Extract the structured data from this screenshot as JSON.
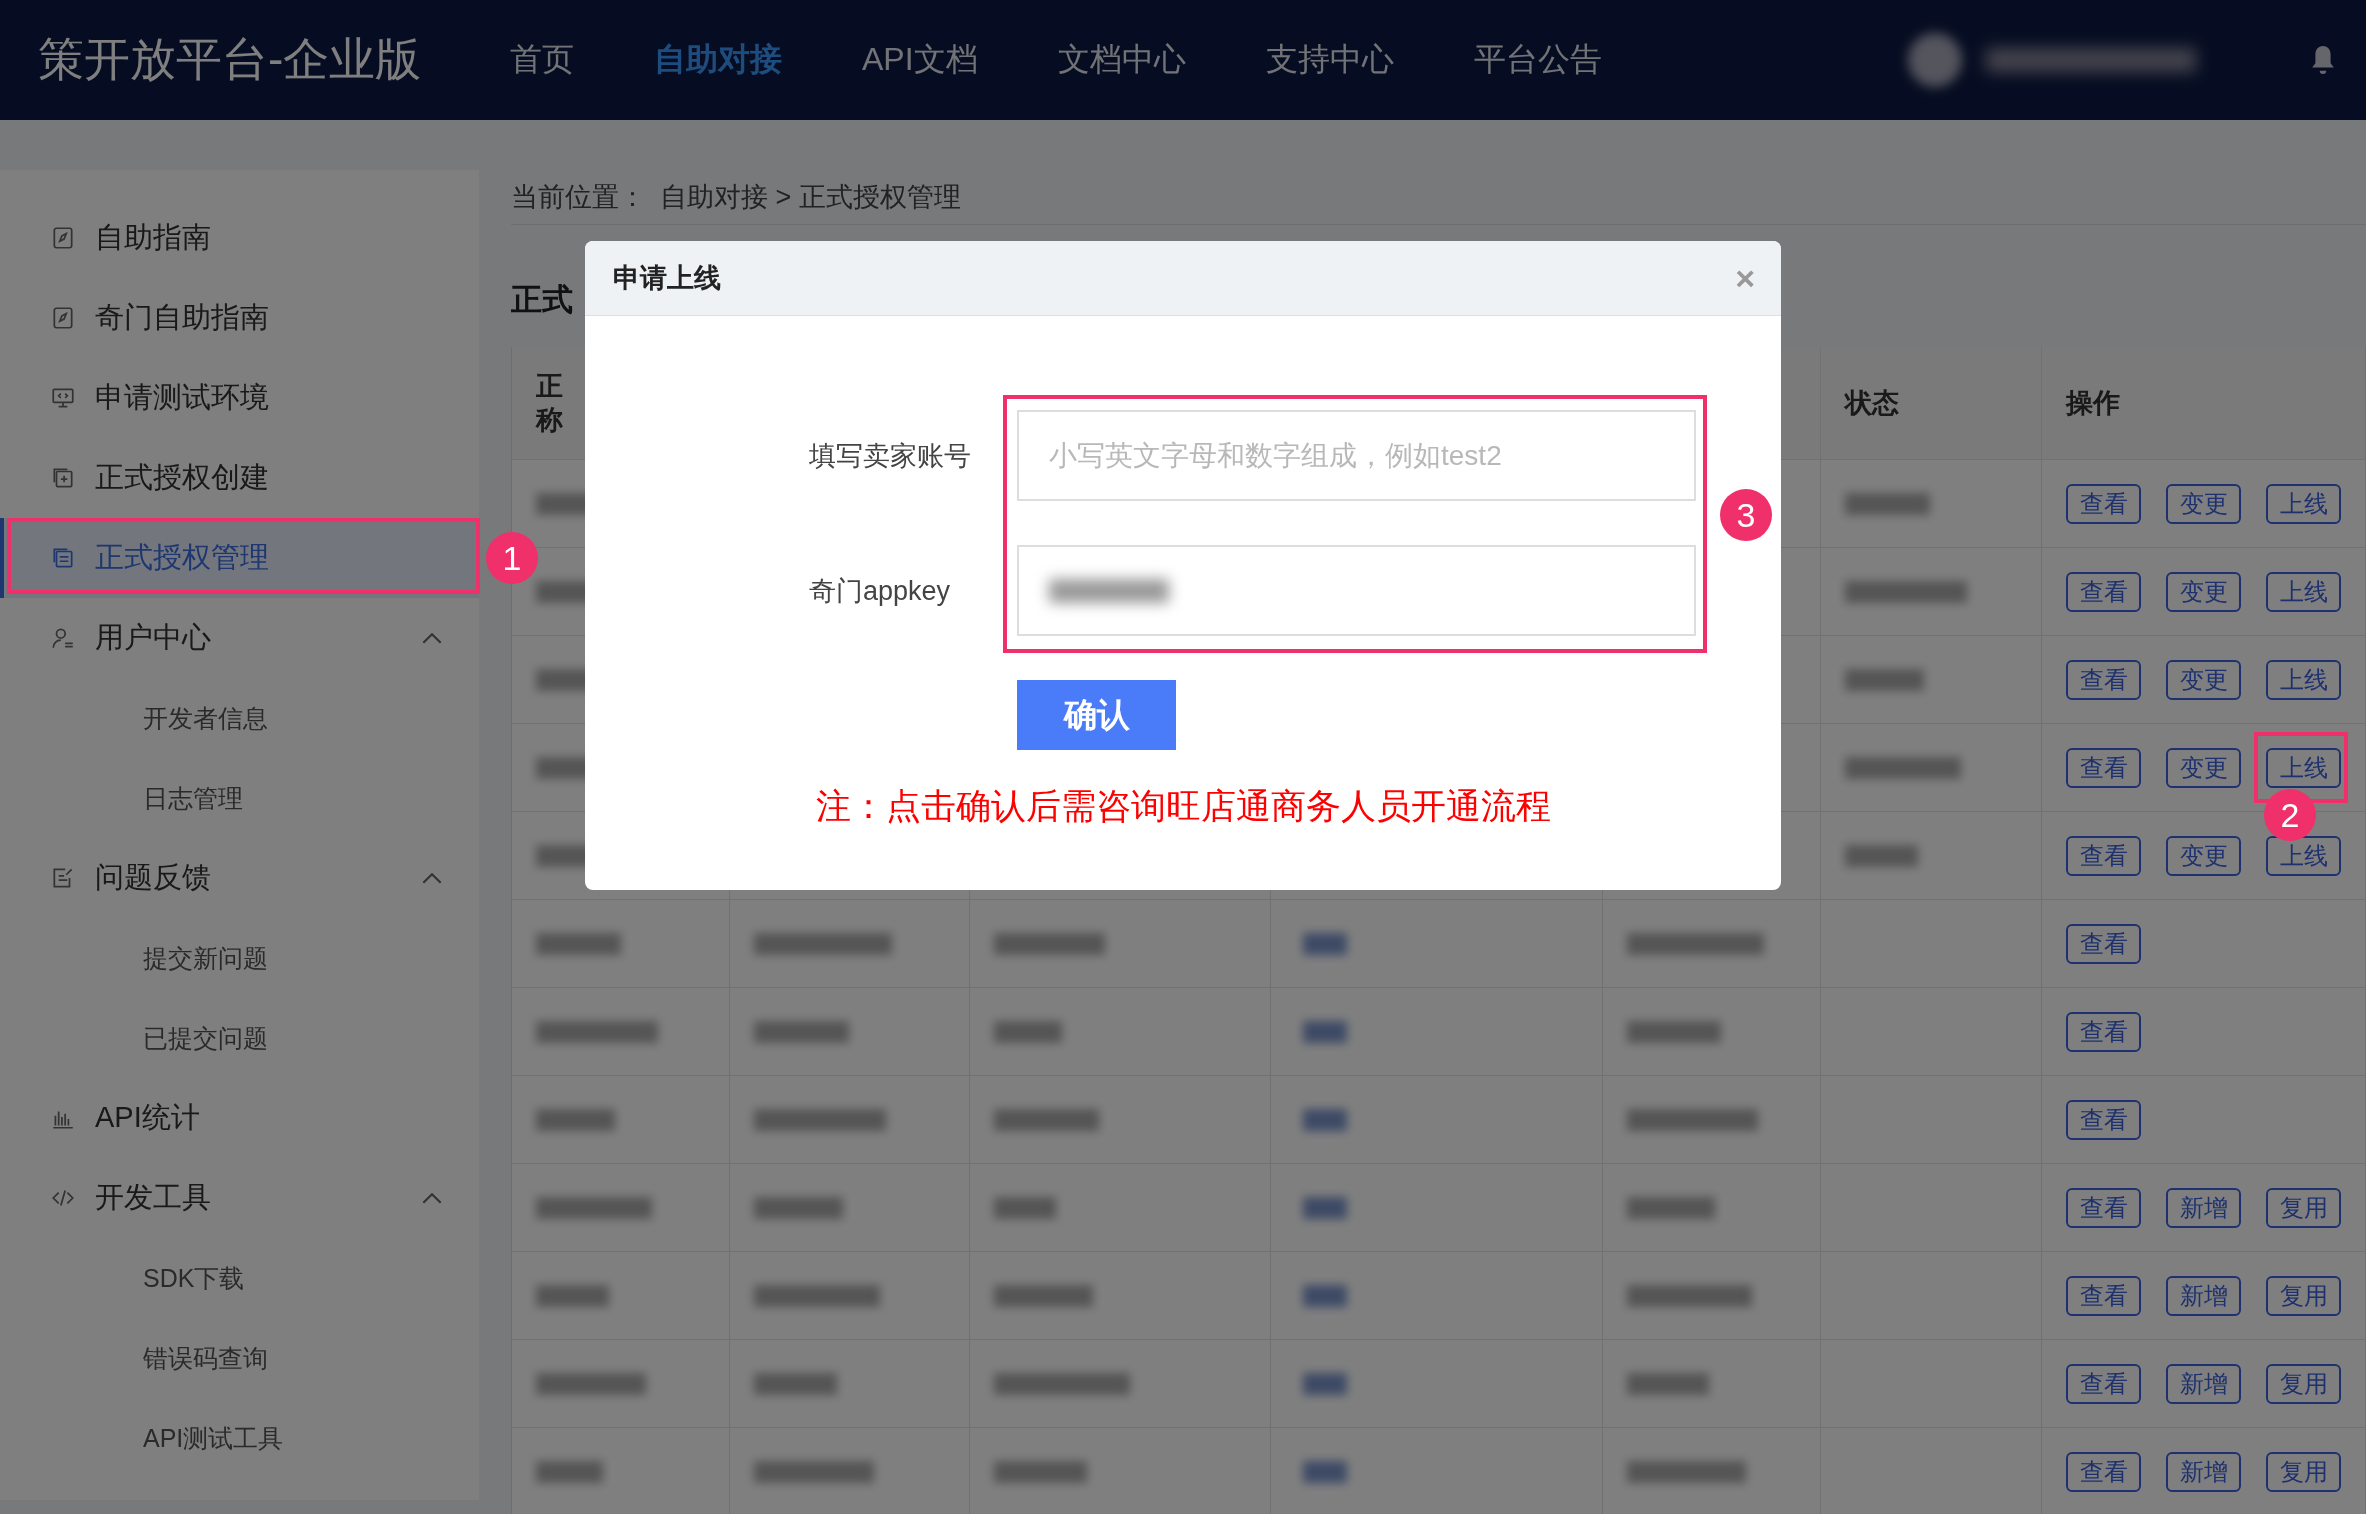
{
  "header": {
    "logo": "策开放平台-企业版",
    "nav": [
      {
        "label": "首页",
        "selected": false
      },
      {
        "label": "自助对接",
        "selected": true
      },
      {
        "label": "API文档",
        "selected": false
      },
      {
        "label": "文档中心",
        "selected": false
      },
      {
        "label": "支持中心",
        "selected": false
      },
      {
        "label": "平台公告",
        "selected": false
      }
    ]
  },
  "sidebar": {
    "items": [
      {
        "label": "自助指南",
        "selected": false
      },
      {
        "label": "奇门自助指南",
        "selected": false
      },
      {
        "label": "申请测试环境",
        "selected": false
      },
      {
        "label": "正式授权创建",
        "selected": false
      },
      {
        "label": "正式授权管理",
        "selected": true
      },
      {
        "label": "用户中心",
        "selected": false,
        "expanded": true,
        "children": [
          {
            "label": "开发者信息",
            "selected": false
          },
          {
            "label": "日志管理",
            "selected": false
          }
        ]
      },
      {
        "label": "问题反馈",
        "selected": false,
        "expanded": true,
        "children": [
          {
            "label": "提交新问题",
            "selected": false
          },
          {
            "label": "已提交问题",
            "selected": false
          }
        ]
      },
      {
        "label": "API统计",
        "selected": false
      },
      {
        "label": "开发工具",
        "selected": false,
        "expanded": true,
        "children": [
          {
            "label": "SDK下载",
            "selected": false
          },
          {
            "label": "错误码查询",
            "selected": false
          },
          {
            "label": "API测试工具",
            "selected": false
          }
        ]
      }
    ]
  },
  "breadcrumb": {
    "label": "当前位置：",
    "path": "自助对接 > 正式授权管理"
  },
  "page_title": "正式",
  "table": {
    "header": {
      "column_1": [
        "正",
        "称"
      ],
      "column_6": "状态",
      "column_7": "操作"
    },
    "rows": [
      {
        "actions": [
          "查看",
          "变更",
          "上线"
        ]
      },
      {
        "actions": [
          "查看",
          "变更",
          "上线"
        ]
      },
      {
        "actions": [
          "查看",
          "变更",
          "上线"
        ]
      },
      {
        "actions": [
          "查看",
          "变更",
          "上线"
        ]
      },
      {
        "actions": [
          "查看",
          "变更",
          "上线"
        ]
      },
      {
        "actions": [
          "查看"
        ]
      },
      {
        "actions": [
          "查看"
        ]
      },
      {
        "actions": [
          "查看"
        ]
      },
      {
        "actions": [
          "查看",
          "新增",
          "复用"
        ]
      },
      {
        "actions": [
          "查看",
          "新增",
          "复用"
        ]
      },
      {
        "actions": [
          "查看",
          "新增",
          "复用"
        ]
      },
      {
        "actions": [
          "查看",
          "新增",
          "复用"
        ]
      }
    ]
  },
  "modal": {
    "title": "申请上线",
    "close": "×",
    "fields": [
      {
        "label": "填写卖家账号",
        "placeholder": "小写英文字母和数字组成，例如test2",
        "redacted": false
      },
      {
        "label": "奇门appkey",
        "redacted": true
      }
    ],
    "confirm": "确认",
    "note": "注：点击确认后需咨询旺店通商务人员开通流程"
  },
  "annotations": [
    {
      "number": "1"
    },
    {
      "number": "2"
    },
    {
      "number": "3"
    }
  ]
}
